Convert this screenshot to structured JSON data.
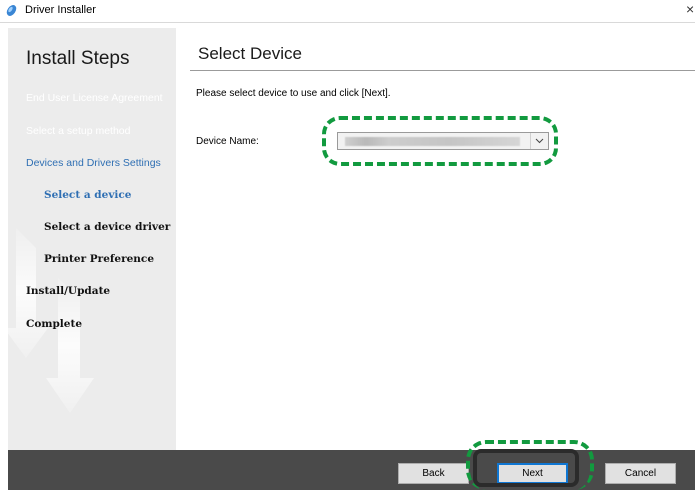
{
  "window": {
    "title": "Driver Installer",
    "close_glyph": "×"
  },
  "sidebar": {
    "heading": "Install Steps",
    "steps": [
      {
        "label": "End User License Agreement",
        "state": "done"
      },
      {
        "label": "Select a setup method",
        "state": "done"
      },
      {
        "label": "Devices and Drivers Settings",
        "state": "current"
      },
      {
        "label": "Select a device",
        "state": "current-sub"
      },
      {
        "label": "Select a device driver",
        "state": "pending-sub"
      },
      {
        "label": "Printer Preference",
        "state": "pending-sub"
      },
      {
        "label": "Install/Update",
        "state": "pending"
      },
      {
        "label": "Complete",
        "state": "pending"
      }
    ]
  },
  "main": {
    "heading": "Select Device",
    "instruction": "Please select device to use and click [Next].",
    "device_name_label": "Device Name:",
    "device_name_value": ""
  },
  "footer": {
    "back_label": "Back",
    "next_label": "Next",
    "cancel_label": "Cancel"
  },
  "colors": {
    "accent_blue": "#2f6fb3",
    "highlight_green": "#129a3f",
    "footer_bg": "#4a4a4a",
    "sidebar_bg": "#ececec"
  },
  "icons": {
    "app": "driver-installer-icon",
    "close": "close-icon",
    "dropdown": "chevron-down-icon"
  }
}
